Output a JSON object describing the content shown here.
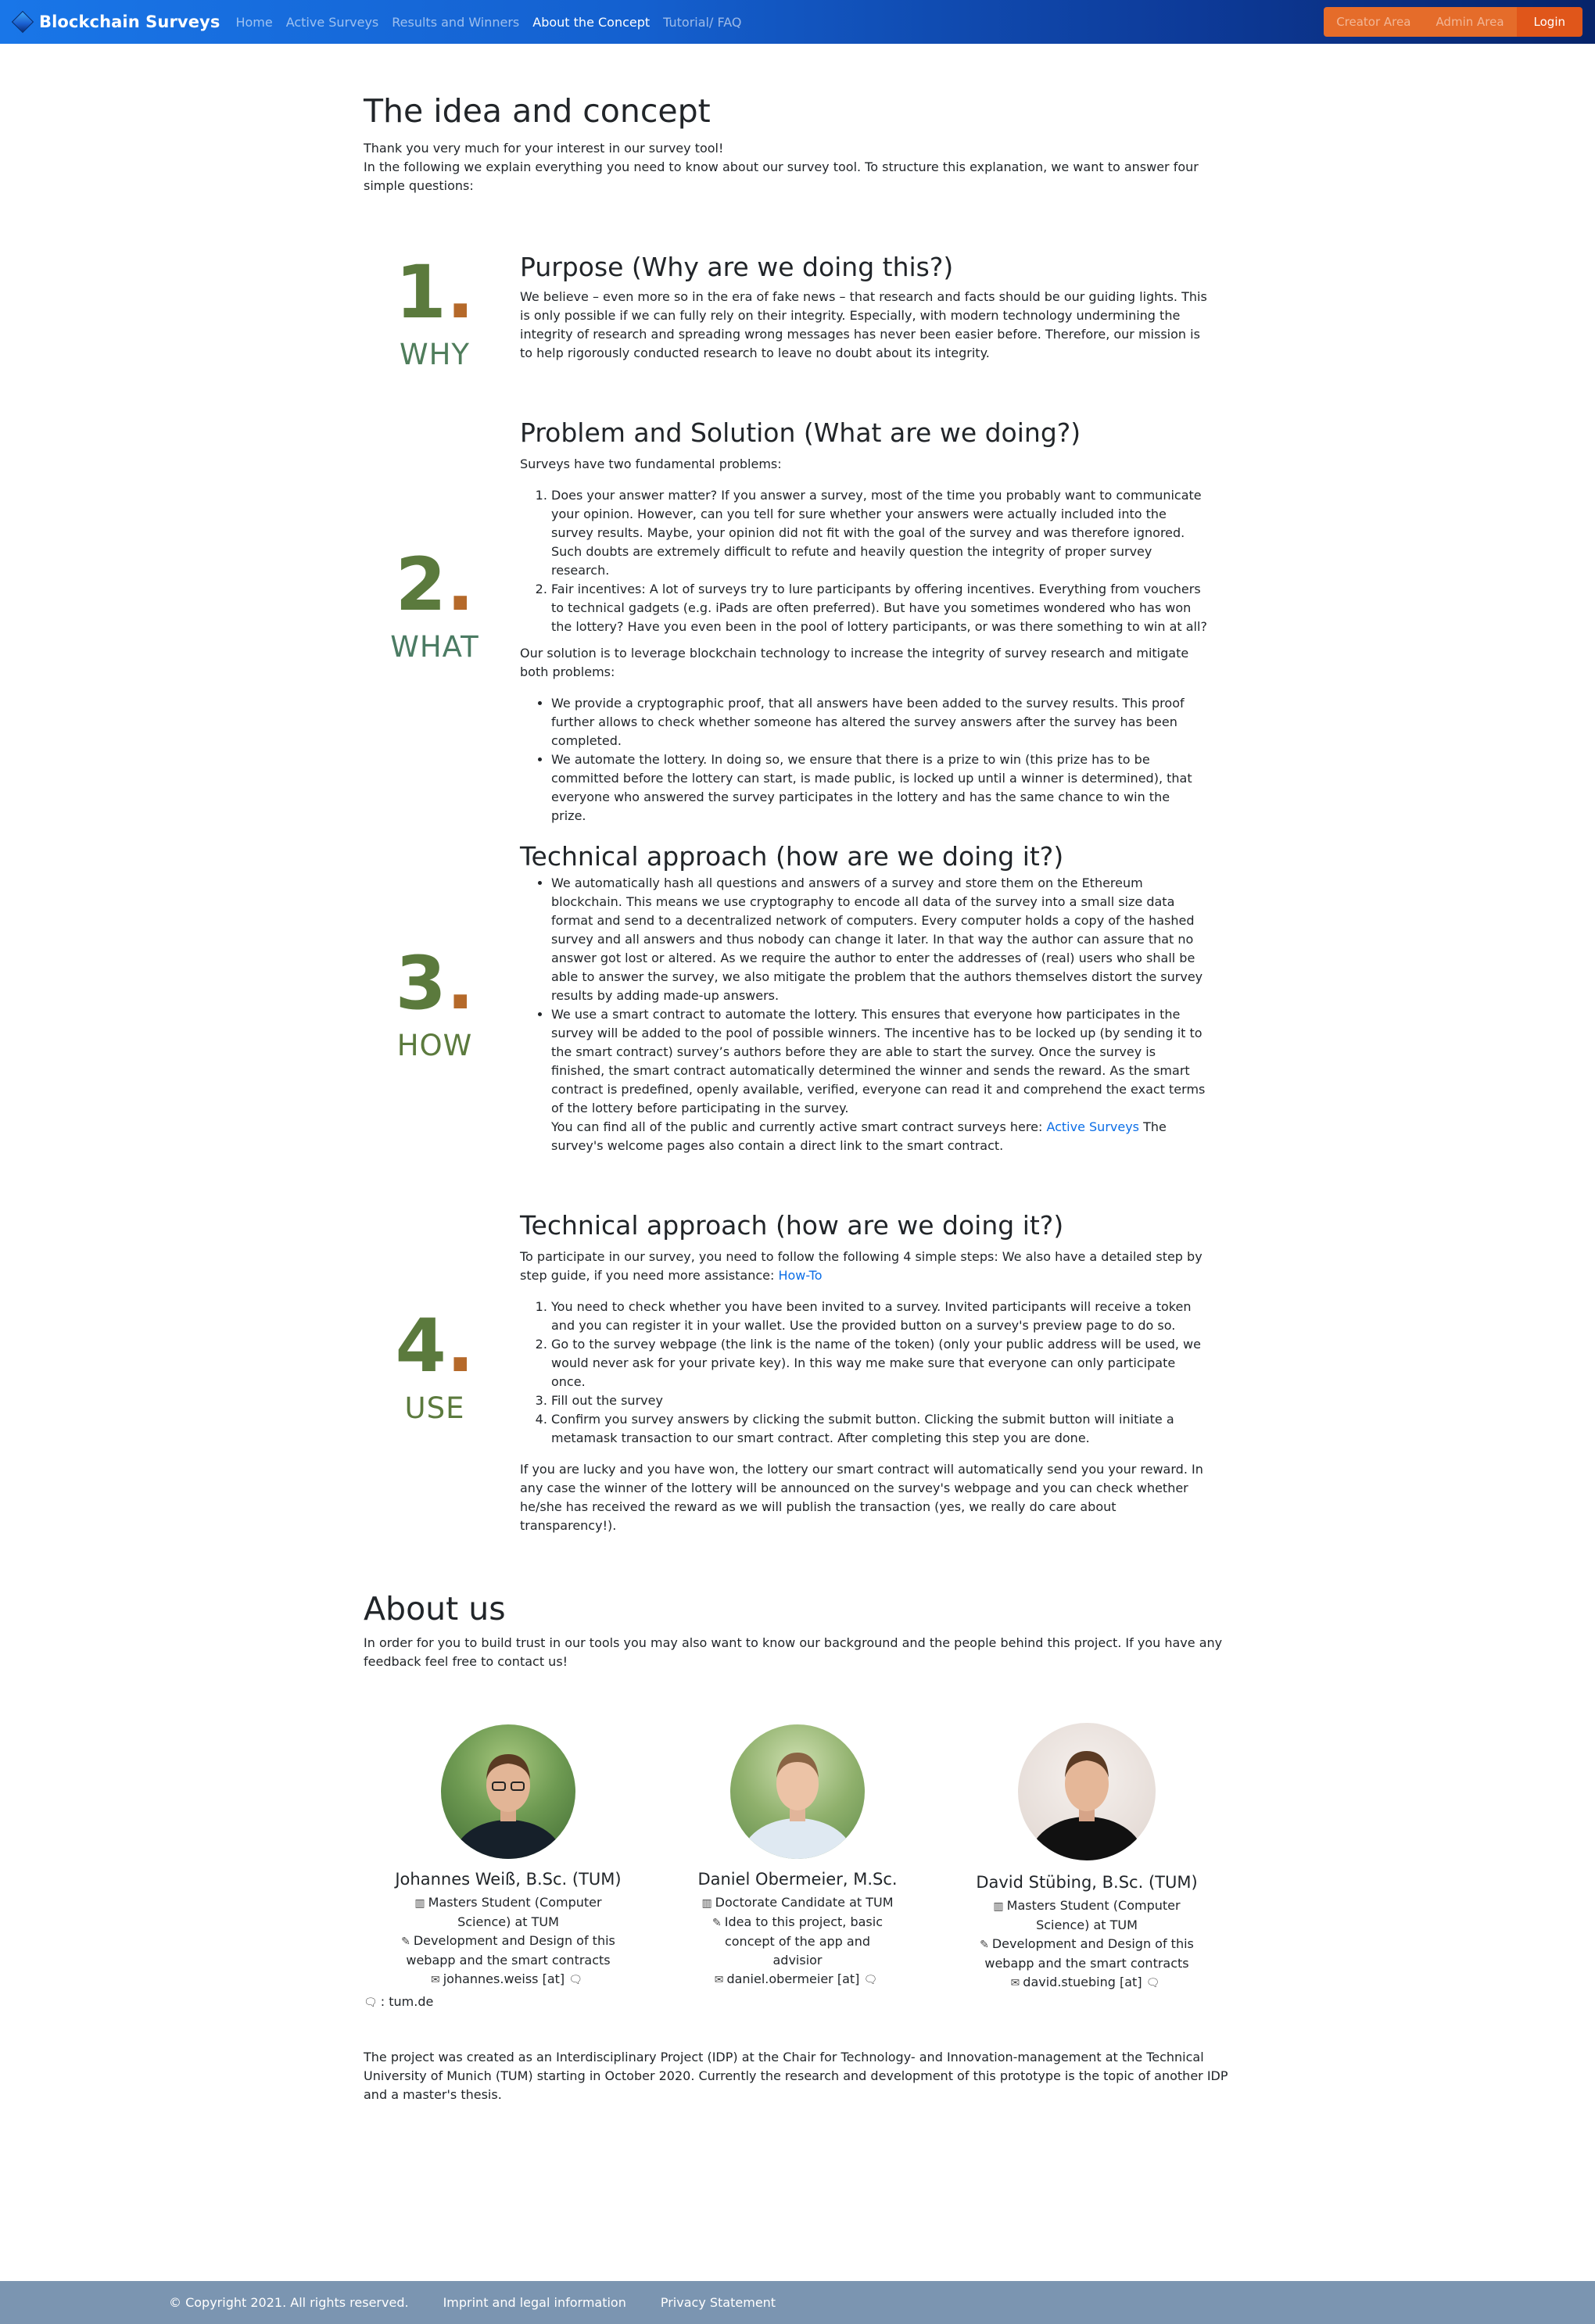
{
  "nav": {
    "brand": "Blockchain Surveys",
    "links": [
      "Home",
      "Active Surveys",
      "Results and Winners",
      "About the Concept",
      "Tutorial/ FAQ"
    ],
    "creator_area": "Creator Area",
    "admin_area": "Admin Area",
    "login": "Login"
  },
  "intro": {
    "title": "The idea and concept",
    "line1": "Thank you very much for your interest in our survey tool!",
    "line2": "In the following we explain everything you need to know about our survey tool. To structure this explanation, we want to answer four simple questions:"
  },
  "sections": [
    {
      "num": "1",
      "label": "WHY",
      "title": "Purpose (Why are we doing this?)",
      "text": "We believe – even more so in the era of fake news – that research and facts should be our guiding lights. This is only possible if we can fully rely on their integrity. Especially, with modern technology undermining the integrity of research and spreading wrong messages has never been easier before. Therefore, our mission is to help rigorously conducted research to leave no doubt about its integrity."
    },
    {
      "num": "2",
      "label": "WHAT",
      "title": "Problem and Solution (What are we doing?)",
      "intro": "Surveys have two fundamental problems:",
      "problems": [
        "Does your answer matter? If you answer a survey, most of the time you probably want to communicate your opinion. However, can you tell for sure whether your answers were actually included into the survey results. Maybe, your opinion did not fit with the goal of the survey and was therefore ignored. Such doubts are extremely difficult to refute and heavily question the integrity of proper survey research.",
        "Fair incentives: A lot of surveys try to lure participants by offering incentives. Everything from vouchers to technical gadgets (e.g. iPads are often preferred). But have you sometimes wondered who has won the lottery? Have you even been in the pool of lottery participants, or was there something to win at all?"
      ],
      "solution_intro": "Our solution is to leverage blockchain technology to increase the integrity of survey research and mitigate both problems:",
      "solutions": [
        "We provide a cryptographic proof, that all answers have been added to the survey results. This proof further allows to check whether someone has altered the survey answers after the survey has been completed.",
        "We automate the lottery. In doing so, we ensure that there is a prize to win (this prize has to be committed before the lottery can start, is made public, is locked up until a winner is determined), that everyone who answered the survey participates in the lottery and has the same chance to win the prize."
      ]
    },
    {
      "num": "3",
      "label": "HOW",
      "title": "Technical approach (how are we doing it?)",
      "items": [
        "We automatically hash all questions and answers of a survey and store them on the Ethereum blockchain. This means we use cryptography to encode all data of the survey into a small size data format and send to a decentralized network of computers. Every computer holds a copy of the hashed survey and all answers and thus nobody can change it later. In that way the author can assure that no answer got lost or altered. As we require the author to enter the addresses of (real) users who shall be able to answer the survey, we also mitigate the problem that the authors themselves distort the survey results by adding made-up answers.",
        "We use a smart contract to automate the lottery. This ensures that everyone how participates in the survey will be added to the pool of possible winners. The incentive has to be locked up (by sending it to the smart contract) survey’s authors before they are able to start the survey. Once the survey is finished, the smart contract automatically determined the winner and sends the reward. As the smart contract is predefined, openly available, verified, everyone can read it and comprehend the exact terms of the lottery before participating in the survey."
      ],
      "find_text": "You can find all of the public and currently active smart contract surveys here:",
      "find_link": "Active Surveys",
      "find_text2": "The survey's welcome pages also contain a direct link to the smart contract."
    },
    {
      "num": "4",
      "label": "USE",
      "title": "Technical approach (how are we doing it?)",
      "intro": "To participate in our survey, you need to follow the following 4 simple steps: We also have a detailed step by step guide, if you need more assistance:",
      "intro_link": "How-To",
      "steps": [
        "You need to check whether you have been invited to a survey. Invited participants will receive a token and you can register it in your wallet. Use the provided button on a survey's preview page to do so.",
        "Go to the survey webpage (the link is the name of the token) (only your public address will be used, we would never ask for your private key). In this way me make sure that everyone can only participate once.",
        "Fill out the survey",
        "Confirm you survey answers by clicking the submit button. Clicking the submit button will initiate a metamask transaction to our smart contract. After completing this step you are done."
      ],
      "outro": "If you are lucky and you have won, the lottery our smart contract will automatically send you your reward. In any case the winner of the lottery will be announced on the survey's webpage and you can check whether he/she has received the reward as we will publish the transaction (yes, we really do care about transparency!)."
    }
  ],
  "about": {
    "title": "About us",
    "text": "In order for you to build trust in our tools you may also want to know our background and the people behind this project. If you have any feedback feel free to contact us!",
    "people": [
      {
        "name": "Johannes Weiß, B.Sc. (TUM)",
        "role": "Masters Student (Computer Science) at TUM",
        "task": "Development and Design of this webapp and the smart contracts",
        "email": "johannes.weiss [at]"
      },
      {
        "name": "Daniel Obermeier, M.Sc.",
        "role": "Doctorate Candidate at TUM",
        "task": "Idea to this project, basic concept of the app and advisior",
        "email": "daniel.obermeier [at]"
      },
      {
        "name": "David Stübing, B.Sc. (TUM)",
        "role": "Masters Student (Computer Science) at TUM",
        "task": "Development and Design of this webapp and the smart contracts",
        "email": "david.stuebing [at]"
      }
    ],
    "domain_note": ": tum.de",
    "project_note": "The project was created as an Interdisciplinary Project (IDP) at the Chair for Technology- and Innovation-management at the Technical University of Munich (TUM) starting in October 2020. Currently the research and development of this prototype is the topic of another IDP and a master's thesis."
  },
  "footer": {
    "copyright": "© Copyright 2021. All rights reserved.",
    "imprint": "Imprint and legal information",
    "privacy": "Privacy Statement"
  },
  "colors": {
    "nav_start": "#1976e8",
    "nav_end": "#07246a",
    "number_green": "#5b7a3d",
    "number_brown": "#b5692a",
    "label_teal": "#3f7f6f",
    "link": "#0b6ee6",
    "footer": "#7b95b1"
  }
}
